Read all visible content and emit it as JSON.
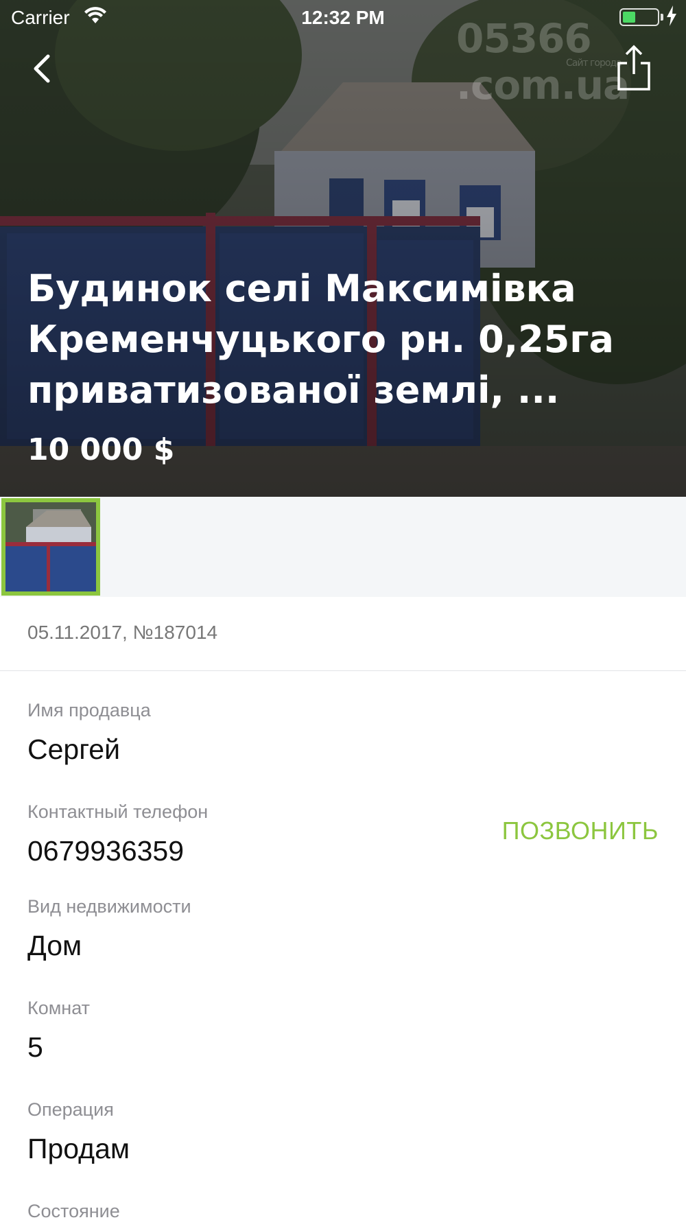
{
  "status_bar": {
    "carrier": "Carrier",
    "time": "12:32 PM"
  },
  "hero": {
    "title": "Будинок селі Максимівка Кременчуцького рн. 0,25га приватизованої землі, ...",
    "price": "10 000 $",
    "watermark": "05366 .com.ua",
    "watermark_sub": "Сайт города"
  },
  "gallery": {
    "thumbnails": 1,
    "selected_color": "#8cc63f"
  },
  "listing": {
    "meta": "05.11.2017, №187014"
  },
  "fields": {
    "seller_label": "Имя продавца",
    "seller_value": "Сергей",
    "phone_label": "Контактный телефон",
    "phone_value": "0679936359",
    "type_label": "Вид недвижимости",
    "type_value": "Дом",
    "rooms_label": "Комнат",
    "rooms_value": "5",
    "operation_label": "Операция",
    "operation_value": "Продам",
    "condition_label": "Состояние"
  },
  "actions": {
    "call_label": "ПОЗВОНИТЬ",
    "accent_color": "#8cc63f"
  },
  "icons": {
    "back": "chevron-left-icon",
    "share": "share-icon",
    "wifi": "wifi-icon",
    "battery": "battery-icon",
    "charging": "bolt-icon"
  }
}
